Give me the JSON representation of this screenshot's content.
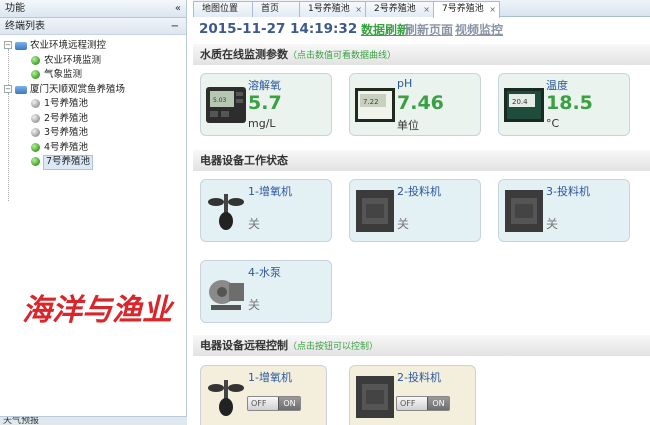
{
  "left_panel": {
    "title": "功能",
    "collapse_icon": "«",
    "sub_title": "终端列表",
    "sub_toggle": "−",
    "tree": [
      {
        "label": "农业环境远程测控",
        "toggle": "−",
        "icon": "folder-icon"
      },
      {
        "label": "农业环境监测",
        "icon": "status-dot-green"
      },
      {
        "label": "气象监测",
        "icon": "status-dot-green"
      },
      {
        "label": "厦门天顺观赏鱼养殖场",
        "toggle": "−",
        "icon": "folder-icon"
      },
      {
        "label": "1号养殖池",
        "icon": "status-dot-grey"
      },
      {
        "label": "2号养殖池",
        "icon": "status-dot-grey"
      },
      {
        "label": "3号养殖池",
        "icon": "status-dot-grey"
      },
      {
        "label": "4号养殖池",
        "icon": "status-dot-green"
      },
      {
        "label": "7号养殖池",
        "icon": "status-dot-green",
        "selected": true
      }
    ],
    "logo_text": "海洋与渔业",
    "bottom_label": "天气预报"
  },
  "tabs": [
    {
      "label": "地图位置",
      "closable": false
    },
    {
      "label": "首页",
      "closable": false
    },
    {
      "label": "1号养殖池",
      "closable": true
    },
    {
      "label": "2号养殖池",
      "closable": true
    },
    {
      "label": "7号养殖池",
      "closable": true,
      "active": true
    }
  ],
  "tab_close": "×",
  "toolbar": {
    "datetime": "2015-11-27 14:19:32",
    "refresh_data": "数据刷新",
    "refresh_page": "刷新页面",
    "video": "视频监控"
  },
  "water_quality": {
    "title": "水质在线监测参数",
    "hint": "（点击数值可看数据曲线）",
    "items": [
      {
        "name": "溶解氧",
        "value": "5.7",
        "unit": "mg/L",
        "screen": "5.03"
      },
      {
        "name": "pH",
        "value": "7.46",
        "unit": "单位",
        "screen": "7.22"
      },
      {
        "name": "温度",
        "value": "18.5",
        "unit": "°C",
        "screen": "20.4"
      }
    ]
  },
  "device_status": {
    "title": "电器设备工作状态",
    "items": [
      {
        "name": "1-增氧机",
        "state": "关",
        "icon": "aerator-icon"
      },
      {
        "name": "2-投料机",
        "state": "关",
        "icon": "feeder-icon"
      },
      {
        "name": "3-投料机",
        "state": "关",
        "icon": "feeder-icon"
      },
      {
        "name": "4-水泵",
        "state": "关",
        "icon": "pump-icon"
      }
    ]
  },
  "device_control": {
    "title": "电器设备远程控制",
    "hint": "（点击按钮可以控制）",
    "items": [
      {
        "name": "1-增氧机",
        "off": "OFF",
        "on": "ON",
        "icon": "aerator-icon"
      },
      {
        "name": "2-投料机",
        "off": "OFF",
        "on": "ON",
        "icon": "feeder-icon"
      }
    ]
  },
  "colors": {
    "accent_green": "#3aa043",
    "title_blue": "#2a57a2",
    "datetime_blue": "#3c5b8c",
    "logo_red": "#d9262a"
  }
}
